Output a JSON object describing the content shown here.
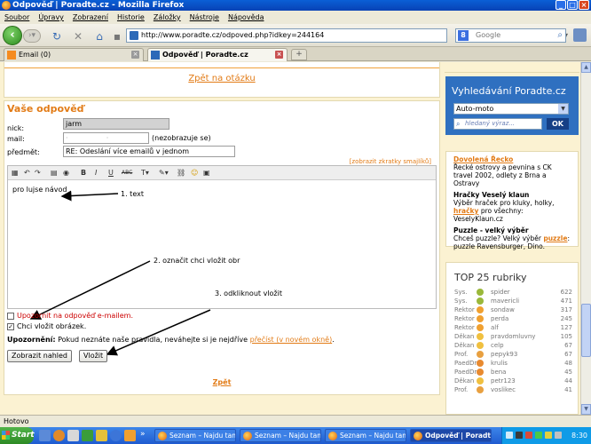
{
  "window": {
    "title": "Odpověď | Poradte.cz - Mozilla Firefox"
  },
  "menu": [
    "Soubor",
    "Úpravy",
    "Zobrazení",
    "Historie",
    "Záložky",
    "Nástroje",
    "Nápověda"
  ],
  "nav": {
    "url": "http://www.poradte.cz/odpoved.php?idkey=244164",
    "search_placeholder": "Google"
  },
  "tabs": [
    {
      "label": "Email (0)"
    },
    {
      "label": "Odpověď | Poradte.cz"
    }
  ],
  "page": {
    "back_to_question": "Zpět na otázku",
    "form_heading": "Vaše odpověď",
    "nick_label": "nick:",
    "nick_value": "jarm",
    "mail_label": "mail:",
    "mail_note": "(nezobrazuje se)",
    "subject_label": "předmět:",
    "subject_value": "RE: Odeslání více emailů v jednom",
    "smiley_link": "[zobrazit zkratky smajlíků]",
    "editor_text": "pro lujse návod",
    "annotation_1": "1. text",
    "annotation_2": "2. označit chci vložit obr",
    "annotation_3": "3. odkliknout vložit",
    "notify_label": "Upozornit na odpověď e-mailem.",
    "insert_image_label": "Chci vložit obrázek.",
    "warning_bold": "Upozornění:",
    "warning_text": "Pokud neznáte naše pravidla, neváhejte si je nejdříve",
    "warning_link": "přečíst (v novém okně)",
    "warning_end": ".",
    "preview_button": "Zobrazit nahled",
    "insert_button": "Vložit",
    "back_link": "Zpět"
  },
  "sidebar": {
    "search_title": "Vyhledávání Poradte.cz",
    "search_category": "Auto-moto",
    "search_placeholder": "hledaný výraz...",
    "ok_label": "OK",
    "ads": [
      {
        "title": "Dovolená Řecko",
        "text": "Řecké ostrovy a pevnina s CK travel 2002, odlety z Brna a Ostravy"
      },
      {
        "title": "Hračky Veselý klaun",
        "text_before": "Výběr hraček pro kluky, holky,",
        "link": "hračky",
        "text_after": "pro všechny: VeselyKlaun.cz"
      },
      {
        "title": "Puzzle - velký výběr",
        "text_before": "Chceš puzzle? Velký výběr",
        "link": "puzzle",
        "text_after": ": puzzle Ravensburger, Dino."
      }
    ],
    "top_title": "TOP 25 rubriky",
    "top_list": [
      {
        "rank": "Sys.",
        "name": "spider",
        "score": "622",
        "icon_color": "#9ab83a"
      },
      {
        "rank": "Sys.",
        "name": "mavericli",
        "score": "471",
        "icon_color": "#9ab83a"
      },
      {
        "rank": "Rektor",
        "name": "sondaw",
        "score": "317",
        "icon_color": "#f0a030"
      },
      {
        "rank": "Rektor",
        "name": "perda",
        "score": "245",
        "icon_color": "#f0a030"
      },
      {
        "rank": "Rektor",
        "name": "alf",
        "score": "127",
        "icon_color": "#f0a030"
      },
      {
        "rank": "Děkan",
        "name": "pravdomluvny",
        "score": "105",
        "icon_color": "#f0c040"
      },
      {
        "rank": "Děkan",
        "name": "celp",
        "score": "67",
        "icon_color": "#f0c040"
      },
      {
        "rank": "Prof.",
        "name": "pepyk93",
        "score": "67",
        "icon_color": "#e8a040"
      },
      {
        "rank": "PaedDr.",
        "name": "krulis",
        "score": "48",
        "icon_color": "#e88a30"
      },
      {
        "rank": "PaedDr.",
        "name": "bena",
        "score": "45",
        "icon_color": "#e88a30"
      },
      {
        "rank": "Děkan",
        "name": "petr123",
        "score": "44",
        "icon_color": "#f0c040"
      },
      {
        "rank": "Prof.",
        "name": "voslikec",
        "score": "41",
        "icon_color": "#e8a040"
      }
    ]
  },
  "status": {
    "text": "Hotovo"
  },
  "taskbar": {
    "start": "Start",
    "tasks": [
      "Seznam – Najdu tam,...",
      "Seznam – Najdu tam,...",
      "Seznam – Najdu tam,...",
      "Odpověď | Poradt..."
    ],
    "clock": "8:30"
  }
}
